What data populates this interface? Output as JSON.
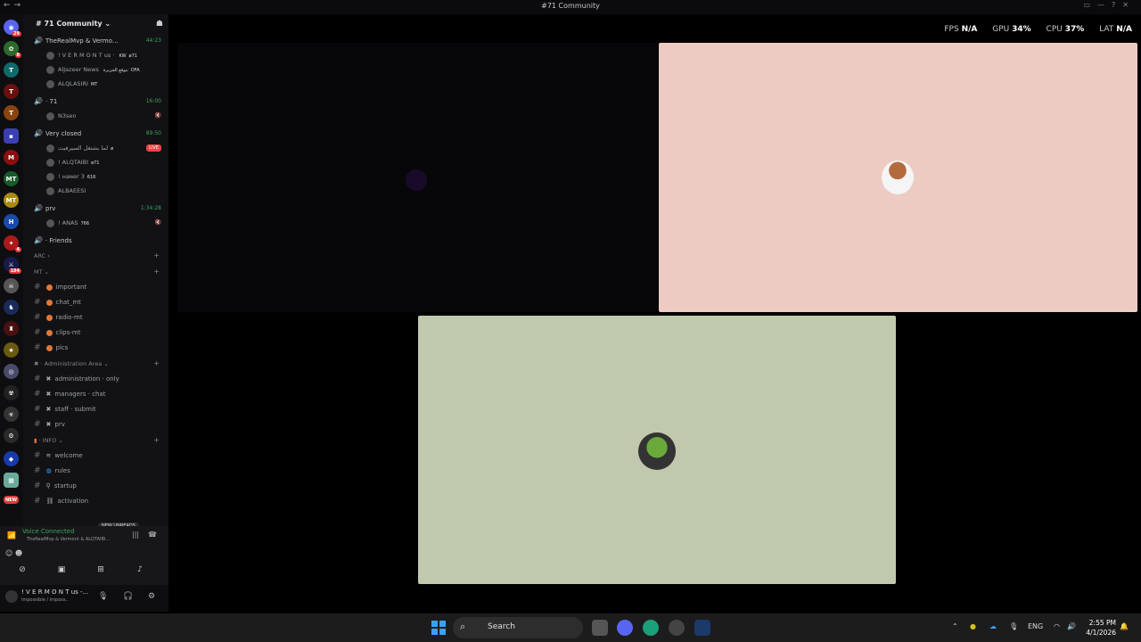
{
  "window": {
    "title": "#71 Community"
  },
  "server": {
    "name": "# 71 Community"
  },
  "voice_channels": [
    {
      "name": "TheRealMvp & Vermo...",
      "time": "44:23",
      "users": [
        {
          "name": "! V E R M O N T us ·",
          "tag": "KW",
          "badge": "ø71"
        },
        {
          "name": "AlJazeer News",
          "tag": "بتوقع الجزيرة",
          "badge": "OFA"
        },
        {
          "name": "ALQLASIRI",
          "tag": "",
          "badge": "MT"
        }
      ]
    },
    {
      "name": "· 71",
      "time": "16:00",
      "users": [
        {
          "name": "N3sen",
          "tag": "",
          "badge": ""
        }
      ]
    },
    {
      "name": "Very closed",
      "time": "89:50",
      "users": [
        {
          "name": "لما بشتغل السيرفيت",
          "tag": "",
          "badge": "ø",
          "live": "LIVE"
        },
        {
          "name": "! ALQTAIBI",
          "tag": "",
          "badge": "ø71"
        },
        {
          "name": "! ʜaɴer 3",
          "tag": "",
          "badge": "616"
        },
        {
          "name": "ALBAEESI",
          "tag": "",
          "badge": ""
        }
      ]
    },
    {
      "name": "prv",
      "time": "1:34:28",
      "users": [
        {
          "name": "! ANAS",
          "tag": "",
          "badge": "766"
        }
      ]
    }
  ],
  "friends_channel": "· Friends",
  "categories": [
    {
      "name": "ARC",
      "channels": []
    },
    {
      "name": "MT",
      "channels": [
        "important",
        "chat_mt",
        "radio-mt",
        "clips-mt",
        "pics"
      ]
    },
    {
      "name": "Administration Area",
      "channels": [
        "administration · only",
        "managers · chat",
        "staff · submit",
        "prv"
      ]
    },
    {
      "name": "INFO",
      "channels": [
        "welcome",
        "rules",
        "startup",
        "activation"
      ]
    }
  ],
  "new_unreads": "NEW UNREADS",
  "voice_panel": {
    "status": "Voice Connected",
    "sub": "TheRealMvp & Vermont & ALQTAIBI..."
  },
  "user_panel": {
    "name": "! V E R M O N T us -...",
    "status": "Impossible / Imposs.."
  },
  "stats": {
    "fps_label": "FPS",
    "fps": "N/A",
    "gpu_label": "GPU",
    "gpu": "34%",
    "cpu_label": "CPU",
    "cpu": "37%",
    "lat_label": "LAT",
    "lat": "N/A"
  },
  "taskbar": {
    "search": "Search",
    "lang": "ENG",
    "time": "2:55 PM",
    "date": "4/1/2026"
  },
  "colors": {
    "voice_green": "#3ba55d",
    "live_red": "#ed4245",
    "tile_pink": "#eccbc2",
    "tile_green": "#c0c8ad"
  }
}
